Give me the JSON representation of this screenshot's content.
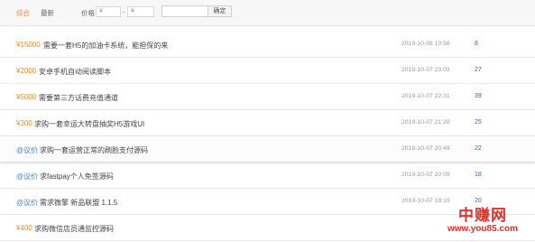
{
  "filters": {
    "tabs": [
      {
        "label": "综合"
      },
      {
        "label": "最新"
      }
    ],
    "price_label": "价格",
    "currency_symbol": "¥",
    "range_separator": "-",
    "confirm_label": "确定",
    "active_color": "#f08c1e"
  },
  "rows": [
    {
      "price": "¥15000",
      "title": "需要一套H5的加油卡系统，能担保的来",
      "date": "2019-10-08 10:56",
      "count": "8"
    },
    {
      "price": "¥2000",
      "title": "安卓手机自动阅读脚本",
      "date": "2019-10-07 23:03",
      "count": "27"
    },
    {
      "price": "¥5000",
      "title": "需要第三方话费充值通道",
      "date": "2019-10-07 22:31",
      "count": "39"
    },
    {
      "price": "¥300",
      "title": "求购一套幸运大转盘抽奖H5游戏UI",
      "date": "2019-10-07 21:28",
      "count": "25"
    },
    {
      "price": "@议价",
      "title": "求购一套运营正常的刷脸支付源码",
      "date": "2019-10-07 20:49",
      "count": "22"
    },
    {
      "price": "@议价",
      "title": "求fastpay个人免签源码",
      "date": "2019-10-07 20:09",
      "count": "18"
    },
    {
      "price": "@议价",
      "title": "需求微擎 新品联盟 1.1.5",
      "date": "2019-10-07 18:19",
      "count": "20"
    },
    {
      "price": "¥400",
      "title": "求购微信店员通监控源码",
      "date": "",
      "count": ""
    }
  ],
  "colors": {
    "price_fixed": "#f08c1e",
    "price_negotiable": "#3a86c8",
    "count": "#3a66b0"
  },
  "watermark": {
    "title": "中赚网",
    "url": "www.you85.com"
  }
}
